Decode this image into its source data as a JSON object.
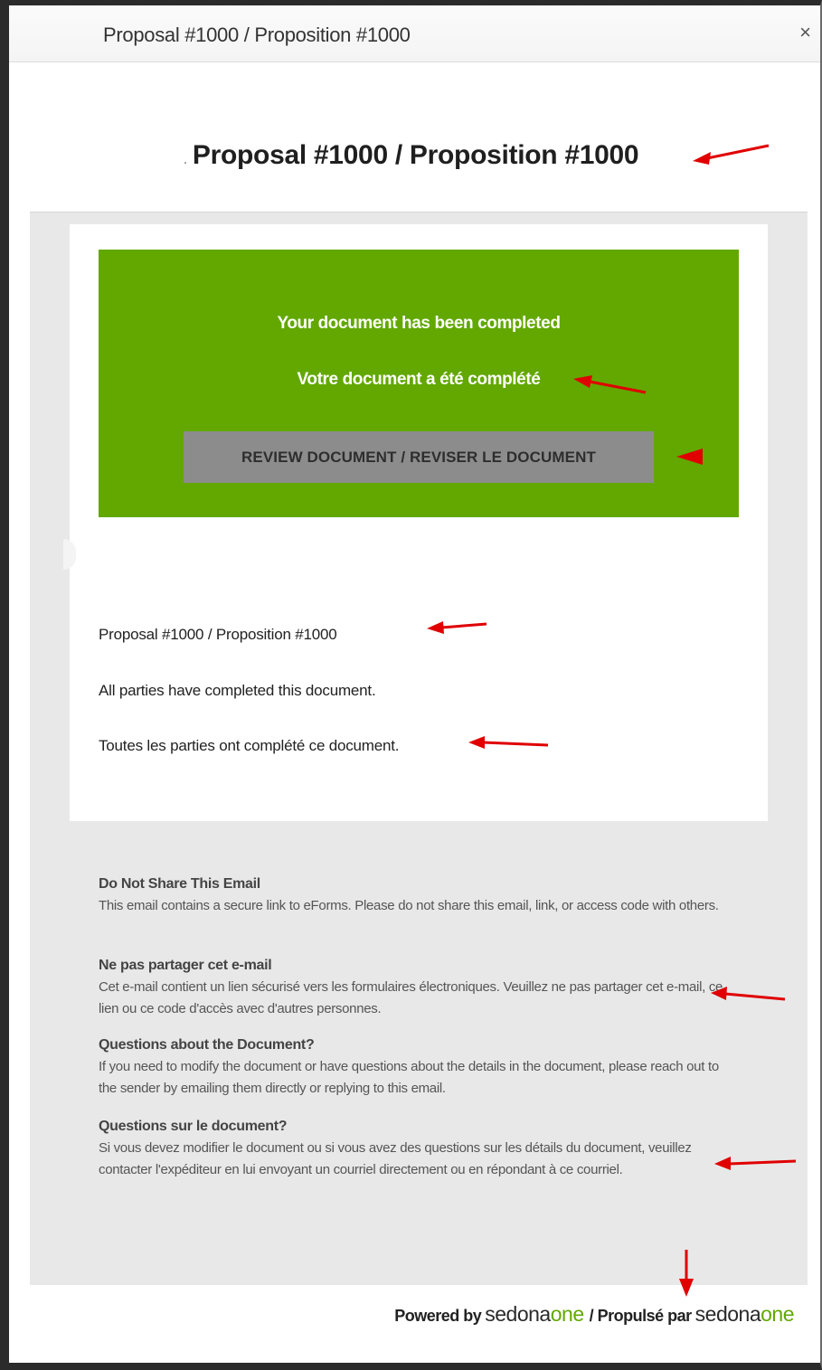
{
  "window": {
    "title": "Proposal #1000 / Proposition #1000",
    "close_symbol": "×"
  },
  "header": {
    "heading": "Proposal #1000 / Proposition #1000",
    "dot": "."
  },
  "banner": {
    "line_en": "Your document has been completed",
    "line_fr": "Votre document a été complété",
    "button_label": "REVIEW DOCUMENT / REVISER LE DOCUMENT",
    "background_color": "#62a800",
    "button_color": "#8c8c8c"
  },
  "content": {
    "proposal_name": "Proposal #1000 / Proposition #1000",
    "status_en": "All parties have completed this document.",
    "status_fr": "Toutes les parties ont complété ce document."
  },
  "footer": {
    "sections": [
      {
        "title": "Do Not Share This Email",
        "body": "This email contains a secure link to eForms. Please do not share this email, link, or access code with others."
      },
      {
        "title": "Ne pas partager cet e-mail",
        "body": "Cet e-mail contient un lien sécurisé vers les formulaires électroniques. Veuillez ne pas partager cet e-mail, ce lien ou ce code d'accès avec d'autres personnes."
      },
      {
        "title": "Questions about the Document?",
        "body": "If you need to modify the document or have questions about the details in the document, please reach out to the sender by emailing them directly or replying to this email."
      },
      {
        "title": "Questions sur le document?",
        "body": "Si vous devez modifier le document ou si vous avez des questions sur les détails du document, veuillez contacter l'expéditeur en lui envoyant un courriel directement ou en répondant à ce courriel."
      }
    ],
    "powered_by": "Powered by",
    "separator": "/ Propulsé par",
    "logo_dark": "sedona",
    "logo_accent": "one",
    "logo_accent_color": "#62a800"
  },
  "annotations": {
    "arrow_color": "#e00000"
  }
}
